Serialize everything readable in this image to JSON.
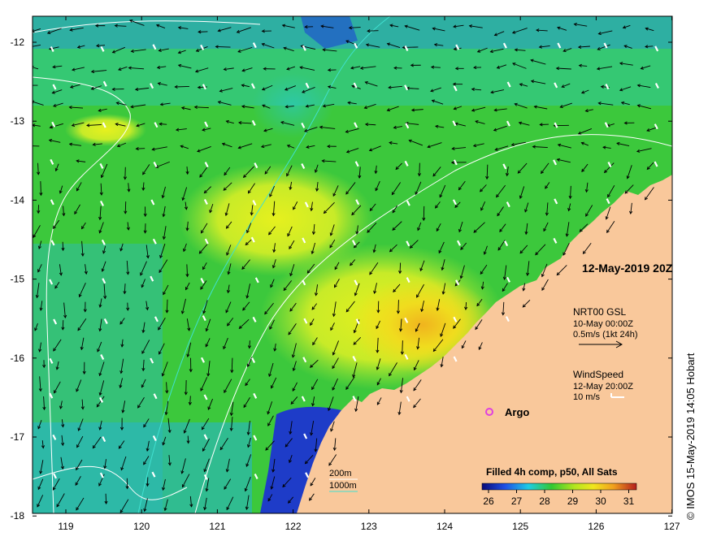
{
  "map": {
    "timestamp": "12-May-2019 20Z",
    "lon_ticks": [
      "119",
      "120",
      "121",
      "122",
      "123",
      "124",
      "125",
      "126",
      "127"
    ],
    "lat_ticks": [
      "-12",
      "-13",
      "-14",
      "-15",
      "-16",
      "-17",
      "-18"
    ],
    "current_legend": {
      "title": "NRT00 GSL",
      "time": "10-May 00:00Z",
      "scale": "0.5m/s (1kt 24h)"
    },
    "wind_legend": {
      "title": "WindSpeed",
      "time": "12-May 20:00Z",
      "scale": "10 m/s"
    },
    "argo_label": "Argo",
    "isobath_labels": [
      "200m",
      "1000m"
    ],
    "colorbar": {
      "title": "Filled 4h comp, p50, All Sats",
      "ticks": [
        "26",
        "27",
        "28",
        "29",
        "30",
        "31"
      ]
    },
    "copyright": "© IMOS 15-May-2019 14:05 Hobart",
    "colors": {
      "land": "#f9c89b",
      "argo": "#e040e0",
      "isobath_200": "#ffffff",
      "isobath_1000": "#40e0d0",
      "sst_cool": "#1e3cc8",
      "sst_mid": "#32c832",
      "sst_warm": "#f0dc1e"
    }
  }
}
